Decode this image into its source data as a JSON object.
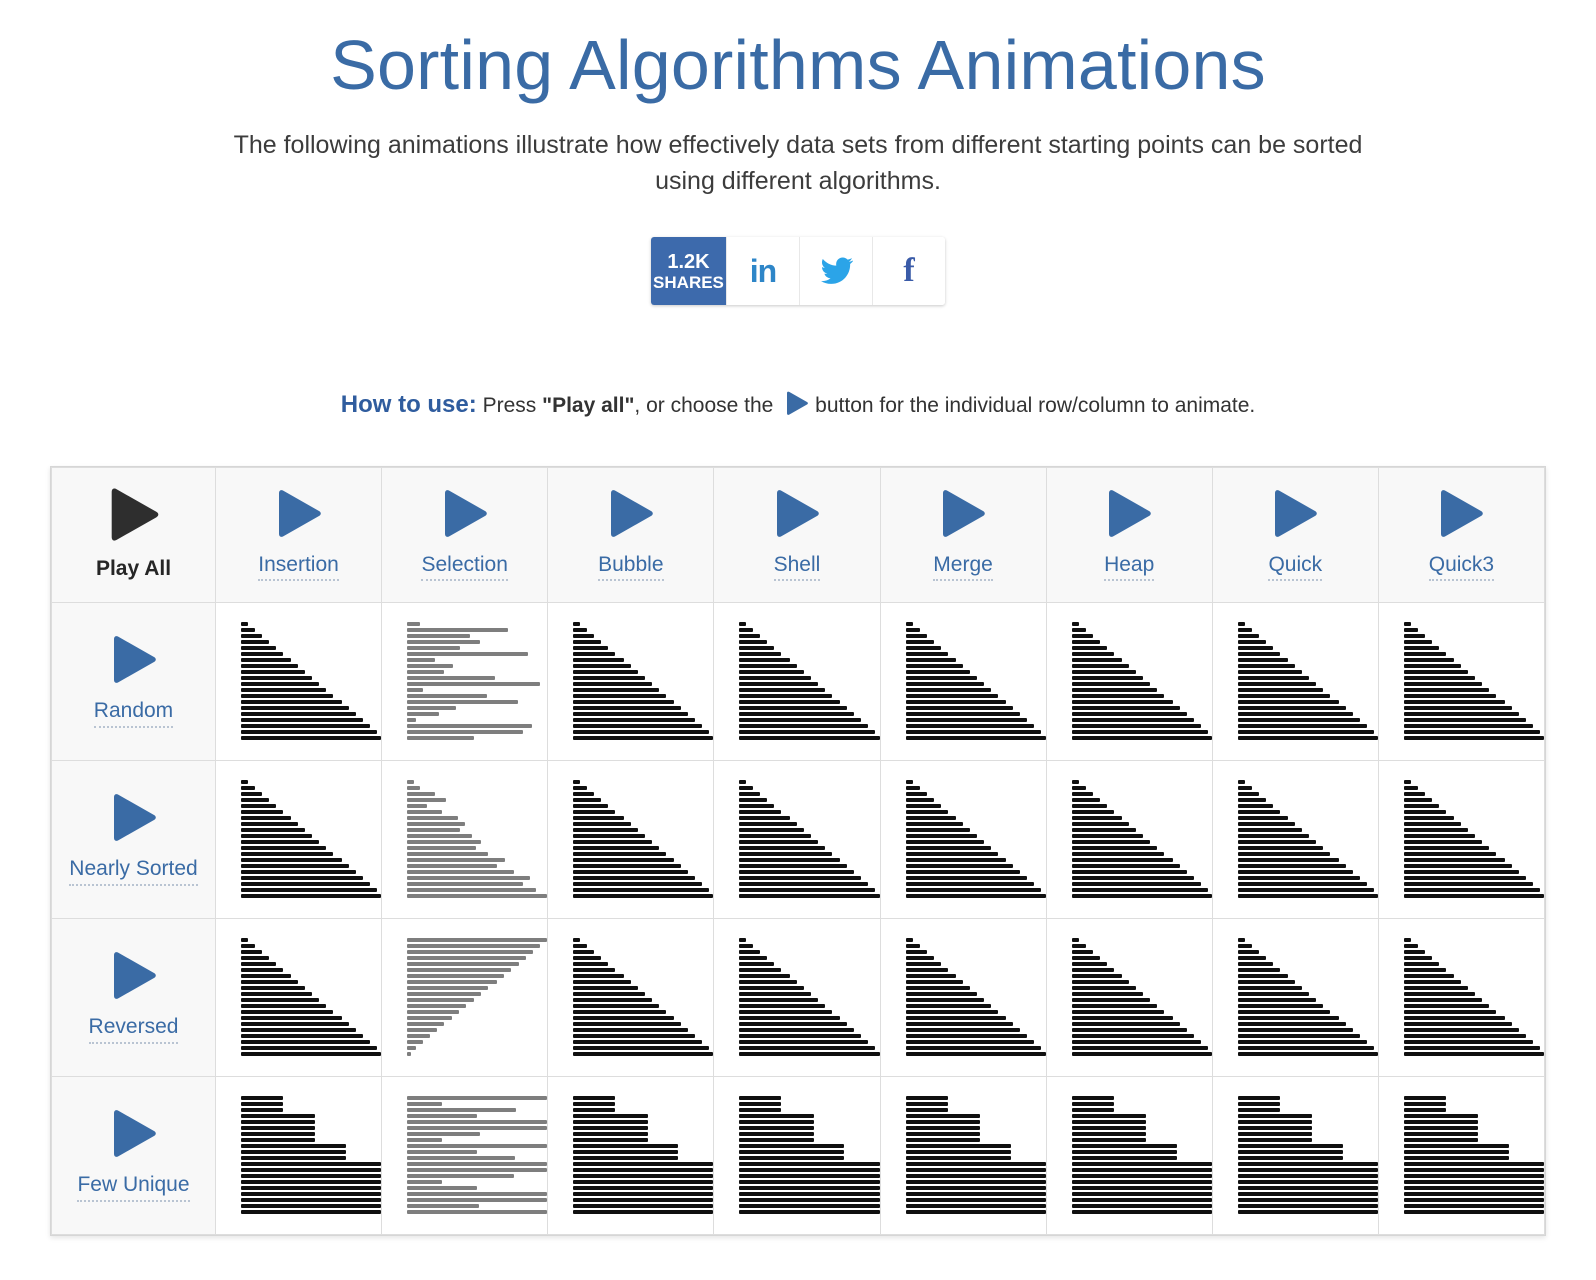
{
  "header": {
    "title": "Sorting Algorithms Animations",
    "intro": "The following animations illustrate how effectively data sets from different starting points can be sorted using different algorithms."
  },
  "share": {
    "count": "1.2K",
    "count_label": "SHARES",
    "buttons": [
      {
        "name": "linkedin-share-button",
        "glyph": "in"
      },
      {
        "name": "twitter-share-button",
        "glyph": "twitter-bird"
      },
      {
        "name": "facebook-share-button",
        "glyph": "f"
      }
    ]
  },
  "howto": {
    "label": "How to use:",
    "text_before": " Press ",
    "quoted": "\"Play all\"",
    "text_middle": ", or choose the ",
    "text_after": "button for the individual row/column to animate."
  },
  "table": {
    "corner": {
      "label": "Play All",
      "icon": "play-icon-dark"
    },
    "columns": [
      {
        "label": "Insertion",
        "icon": "play-icon"
      },
      {
        "label": "Selection",
        "icon": "play-icon"
      },
      {
        "label": "Bubble",
        "icon": "play-icon"
      },
      {
        "label": "Shell",
        "icon": "play-icon"
      },
      {
        "label": "Merge",
        "icon": "play-icon"
      },
      {
        "label": "Heap",
        "icon": "play-icon"
      },
      {
        "label": "Quick",
        "icon": "play-icon"
      },
      {
        "label": "Quick3",
        "icon": "play-icon"
      }
    ],
    "rows": [
      {
        "label": "Random",
        "icon": "play-icon"
      },
      {
        "label": "Nearly Sorted",
        "icon": "play-icon"
      },
      {
        "label": "Reversed",
        "icon": "play-icon"
      },
      {
        "label": "Few Unique",
        "icon": "play-icon"
      }
    ]
  },
  "colors": {
    "accent_blue": "#3A6BA5",
    "share_blue": "#3D6AAC",
    "linkedin_blue": "#2E86C8",
    "twitter_blue": "#2BA4E8",
    "facebook_blue": "#3A5BA8",
    "bar_sorted": "#101010",
    "bar_unsorted": "#7e7e7e",
    "grid_border": "#dddddd"
  },
  "viz": {
    "bar_count": 20,
    "sorted_pattern": [
      5,
      10,
      15,
      20,
      25,
      30,
      36,
      41,
      46,
      51,
      56,
      61,
      66,
      72,
      77,
      82,
      87,
      92,
      97,
      100
    ],
    "few_unique_pattern": [
      30,
      30,
      30,
      53,
      53,
      53,
      53,
      53,
      75,
      75,
      75,
      100,
      100,
      100,
      100,
      100,
      100,
      100,
      100,
      100
    ],
    "random_pattern": [
      9,
      72,
      45,
      52,
      38,
      86,
      20,
      33,
      26,
      63,
      95,
      11,
      57,
      79,
      35,
      23,
      6,
      89,
      83,
      48
    ],
    "nearly_sorted_pattern": [
      5,
      9,
      20,
      28,
      14,
      25,
      36,
      41,
      38,
      46,
      53,
      49,
      58,
      70,
      64,
      76,
      88,
      83,
      92,
      100
    ],
    "reversed_pattern": [
      100,
      95,
      90,
      85,
      80,
      74,
      69,
      64,
      58,
      53,
      48,
      42,
      37,
      32,
      26,
      21,
      16,
      11,
      6,
      3
    ],
    "few_unique_random_pattern": [
      100,
      25,
      78,
      50,
      100,
      100,
      52,
      25,
      100,
      50,
      77,
      100,
      100,
      76,
      25,
      50,
      100,
      100,
      51,
      100
    ],
    "unsorted_column_index": 1
  }
}
